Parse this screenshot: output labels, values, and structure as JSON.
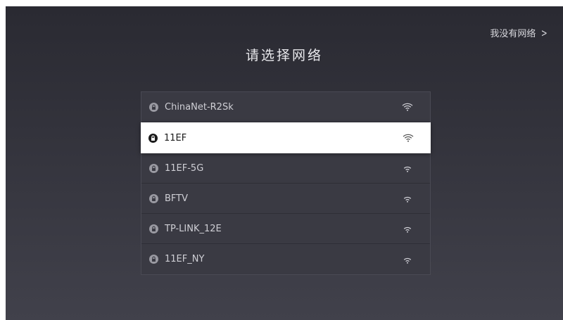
{
  "header": {
    "title": "请选择网络",
    "no_network_label": "我没有网络"
  },
  "networks": [
    {
      "ssid": "ChinaNet-R2Sk",
      "locked": true,
      "selected": false,
      "signal": "strong"
    },
    {
      "ssid": "11EF",
      "locked": true,
      "selected": true,
      "signal": "strong"
    },
    {
      "ssid": "11EF-5G",
      "locked": true,
      "selected": false,
      "signal": "medium"
    },
    {
      "ssid": "BFTV",
      "locked": true,
      "selected": false,
      "signal": "medium"
    },
    {
      "ssid": "TP-LINK_12E",
      "locked": true,
      "selected": false,
      "signal": "medium"
    },
    {
      "ssid": "11EF_NY",
      "locked": true,
      "selected": false,
      "signal": "medium"
    }
  ],
  "icons": {
    "lock": "lock-icon",
    "wifi": "wifi-icon",
    "chevron": "chevron-right-icon"
  },
  "colors": {
    "background_top": "#2a2a32",
    "background_bottom": "#41414b",
    "list_bg": "#3a3a43",
    "selected_bg": "#ffffff",
    "text_light": "#cfcfd5",
    "text_dark": "#1a1a1a"
  }
}
